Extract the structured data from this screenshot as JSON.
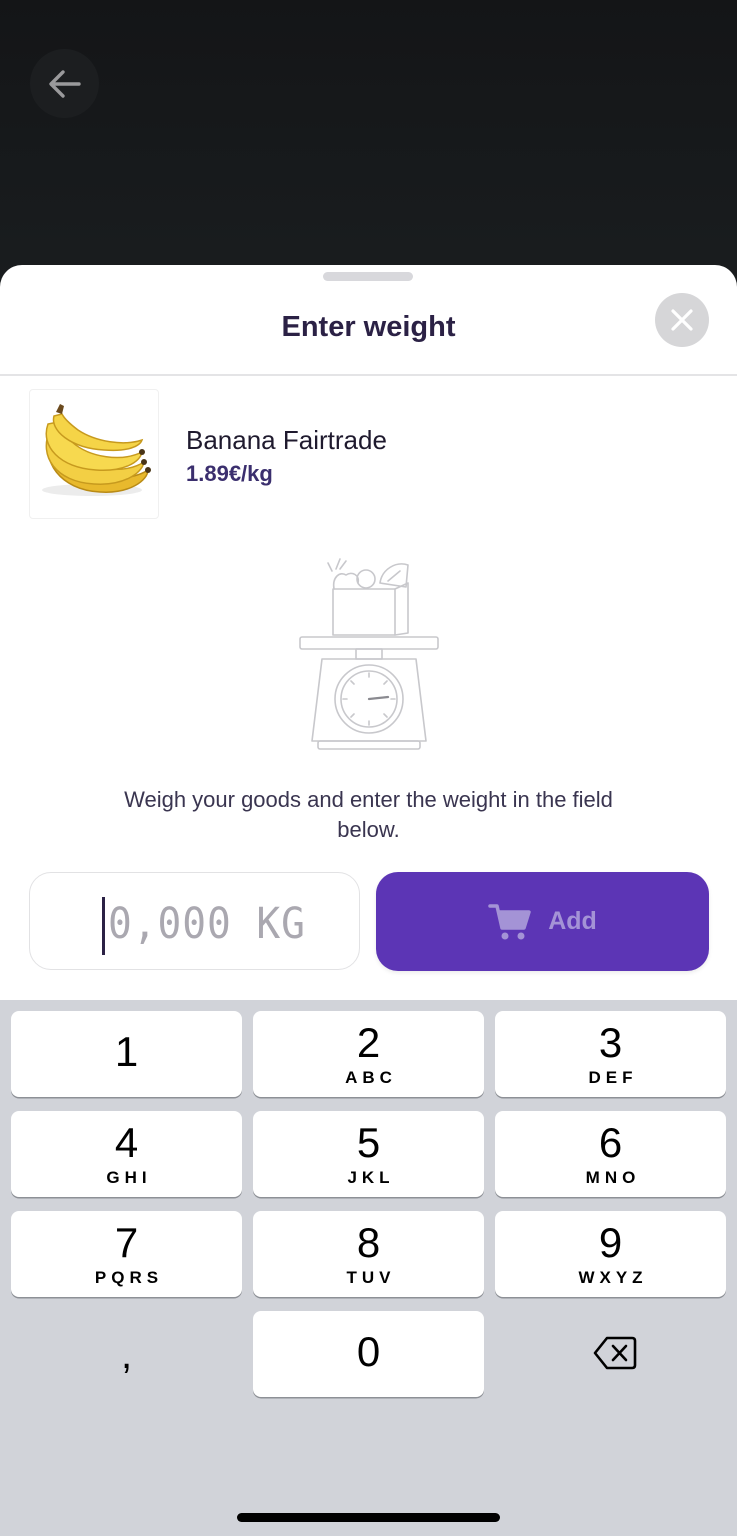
{
  "header": {
    "back_icon": "arrow-left-icon"
  },
  "sheet": {
    "title": "Enter weight",
    "close_icon": "close-icon"
  },
  "product": {
    "name": "Banana Fairtrade",
    "price": "1.89€/kg",
    "image": "banana-image"
  },
  "illustration": "kitchen-scale-icon",
  "instruction": "Weigh your goods and enter the weight in the field below.",
  "weight_input": {
    "placeholder": "0,000 KG",
    "value": ""
  },
  "add_button": {
    "label": "Add",
    "icon": "cart-icon",
    "color": "#5c35b5"
  },
  "keypad": {
    "keys": [
      {
        "digit": "1",
        "letters": ""
      },
      {
        "digit": "2",
        "letters": "ABC"
      },
      {
        "digit": "3",
        "letters": "DEF"
      },
      {
        "digit": "4",
        "letters": "GHI"
      },
      {
        "digit": "5",
        "letters": "JKL"
      },
      {
        "digit": "6",
        "letters": "MNO"
      },
      {
        "digit": "7",
        "letters": "PQRS"
      },
      {
        "digit": "8",
        "letters": "TUV"
      },
      {
        "digit": "9",
        "letters": "WXYZ"
      },
      {
        "digit": "0",
        "letters": ""
      }
    ],
    "decimal": ",",
    "delete_icon": "backspace-icon"
  }
}
